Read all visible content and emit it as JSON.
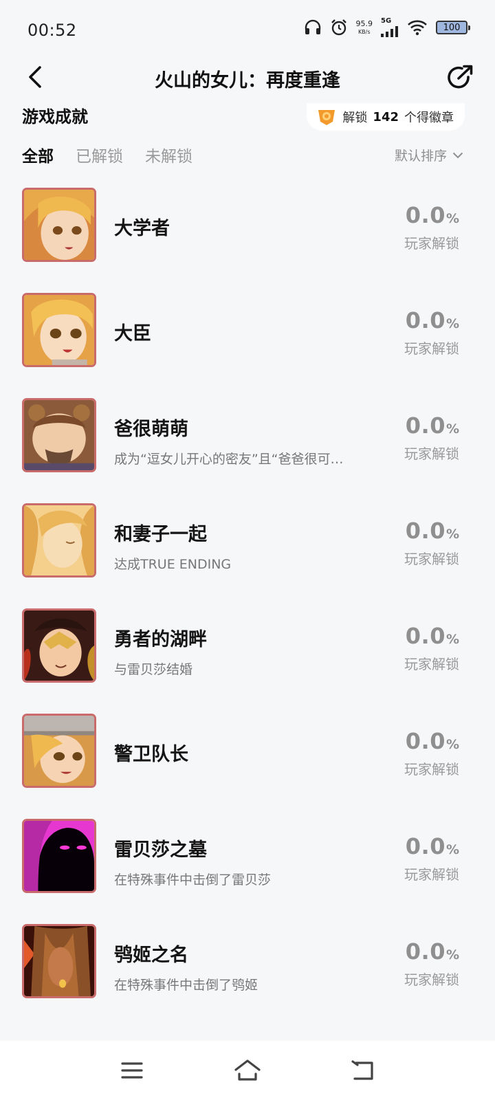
{
  "status": {
    "time": "00:52",
    "net_speed": "95.9",
    "net_unit": "KB/s",
    "network": "5G",
    "battery": "100"
  },
  "header": {
    "title": "火山的女儿：再度重逢"
  },
  "section": {
    "title": "游戏成就",
    "badge_prefix": "解锁",
    "badge_count": "142",
    "badge_suffix": "个得徽章"
  },
  "tabs": [
    {
      "label": "全部",
      "active": true
    },
    {
      "label": "已解锁",
      "active": false
    },
    {
      "label": "未解锁",
      "active": false
    }
  ],
  "sort_label": "默认排序",
  "achievements": [
    {
      "name": "大学者",
      "desc": "",
      "rate": "0.0",
      "rate_label": "玩家解锁"
    },
    {
      "name": "大臣",
      "desc": "",
      "rate": "0.0",
      "rate_label": "玩家解锁"
    },
    {
      "name": "爸很萌萌",
      "desc": "成为“逗女儿开心的密友”且“爸爸很可…",
      "rate": "0.0",
      "rate_label": "玩家解锁"
    },
    {
      "name": "和妻子一起",
      "desc": "达成TRUE ENDING",
      "rate": "0.0",
      "rate_label": "玩家解锁"
    },
    {
      "name": "勇者的湖畔",
      "desc": "与雷贝莎结婚",
      "rate": "0.0",
      "rate_label": "玩家解锁"
    },
    {
      "name": "警卫队长",
      "desc": "",
      "rate": "0.0",
      "rate_label": "玩家解锁"
    },
    {
      "name": "雷贝莎之墓",
      "desc": "在特殊事件中击倒了雷贝莎",
      "rate": "0.0",
      "rate_label": "玩家解锁"
    },
    {
      "name": "鸮姬之名",
      "desc": "在特殊事件中击倒了鸮姬",
      "rate": "0.0",
      "rate_label": "玩家解锁"
    }
  ],
  "percent_sign": "%",
  "icons": {
    "back": "chevron-left-icon",
    "share": "share-icon",
    "badge": "badge-icon",
    "sort": "chevron-down-icon",
    "nav_menu": "menu-icon",
    "nav_home": "home-icon",
    "nav_back": "return-icon"
  },
  "colors": {
    "background": "#f6f7f9",
    "thumb_border": "#c96b6b",
    "badge_orange": "#f39a2d",
    "muted_text": "#8f8f8f"
  }
}
